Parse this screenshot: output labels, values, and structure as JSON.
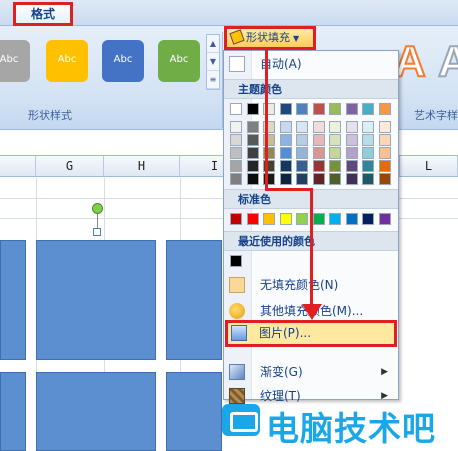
{
  "ribbon": {
    "tab_format": "格式",
    "shape_styles_label": "形状样式",
    "art_text_label": "艺术字样",
    "fill_button_label": "形状填充",
    "abc_buttons": [
      {
        "label": "Abc",
        "color": "#a6a6a6"
      },
      {
        "label": "Abc",
        "color": "#ffc000"
      },
      {
        "label": "Abc",
        "color": "#4472c4"
      },
      {
        "label": "Abc",
        "color": "#70ad47"
      }
    ],
    "gallery_scroll": [
      "▲",
      "▼",
      "≡"
    ],
    "art_letters": [
      "A",
      "A"
    ]
  },
  "sheet": {
    "columns": [
      "G",
      "H",
      "I",
      "L"
    ]
  },
  "menu": {
    "auto": "自动(A)",
    "theme_colors_title": "主题颜色",
    "standard_colors_title": "标准色",
    "recent_colors_title": "最近使用的颜色",
    "no_fill": "无填充颜色(N)",
    "more_colors": "其他填充颜色(M)...",
    "picture": "图片(P)...",
    "gradient": "渐变(G)",
    "texture": "纹理(T)",
    "theme_top_row": [
      "#ffffff",
      "#000000",
      "#eeece1",
      "#1f497d",
      "#4f81bd",
      "#c0504d",
      "#9bbb59",
      "#8064a2",
      "#4bacc6",
      "#f79646"
    ],
    "theme_shades": [
      [
        "#f2f2f2",
        "#7f7f7f",
        "#ddd9c3",
        "#c6d9f0",
        "#dbe5f1",
        "#f2dcdb",
        "#ebf1dd",
        "#e5e0ec",
        "#dbeef3",
        "#fdeada"
      ],
      [
        "#d8d8d8",
        "#595959",
        "#c4bd97",
        "#8db3e2",
        "#b8cce4",
        "#e5b9b7",
        "#d7e3bc",
        "#ccc1d9",
        "#b7dde8",
        "#fbd5b5"
      ],
      [
        "#bfbfbf",
        "#3f3f3f",
        "#938953",
        "#548dd4",
        "#95b3d7",
        "#d99694",
        "#c3d69b",
        "#b2a2c7",
        "#92cddc",
        "#fac08f"
      ],
      [
        "#a5a5a5",
        "#262626",
        "#494429",
        "#17365d",
        "#366092",
        "#953734",
        "#76923c",
        "#5f497a",
        "#31859b",
        "#e36c09"
      ],
      [
        "#7f7f7f",
        "#0c0c0c",
        "#1d1b10",
        "#0f243e",
        "#244061",
        "#632423",
        "#4f6128",
        "#3f3151",
        "#205867",
        "#974806"
      ]
    ],
    "standard_row": [
      "#c00000",
      "#ff0000",
      "#ffc000",
      "#ffff00",
      "#92d050",
      "#00b050",
      "#00b0f0",
      "#0070c0",
      "#002060",
      "#7030a0"
    ],
    "recent_row": [
      "#000000"
    ]
  },
  "watermark": {
    "text": "电脑技术吧"
  },
  "colors": {
    "highlight_red": "#e02020",
    "shape_blue": "#5b8fd0",
    "menu_hover": "#ffe8a0"
  }
}
